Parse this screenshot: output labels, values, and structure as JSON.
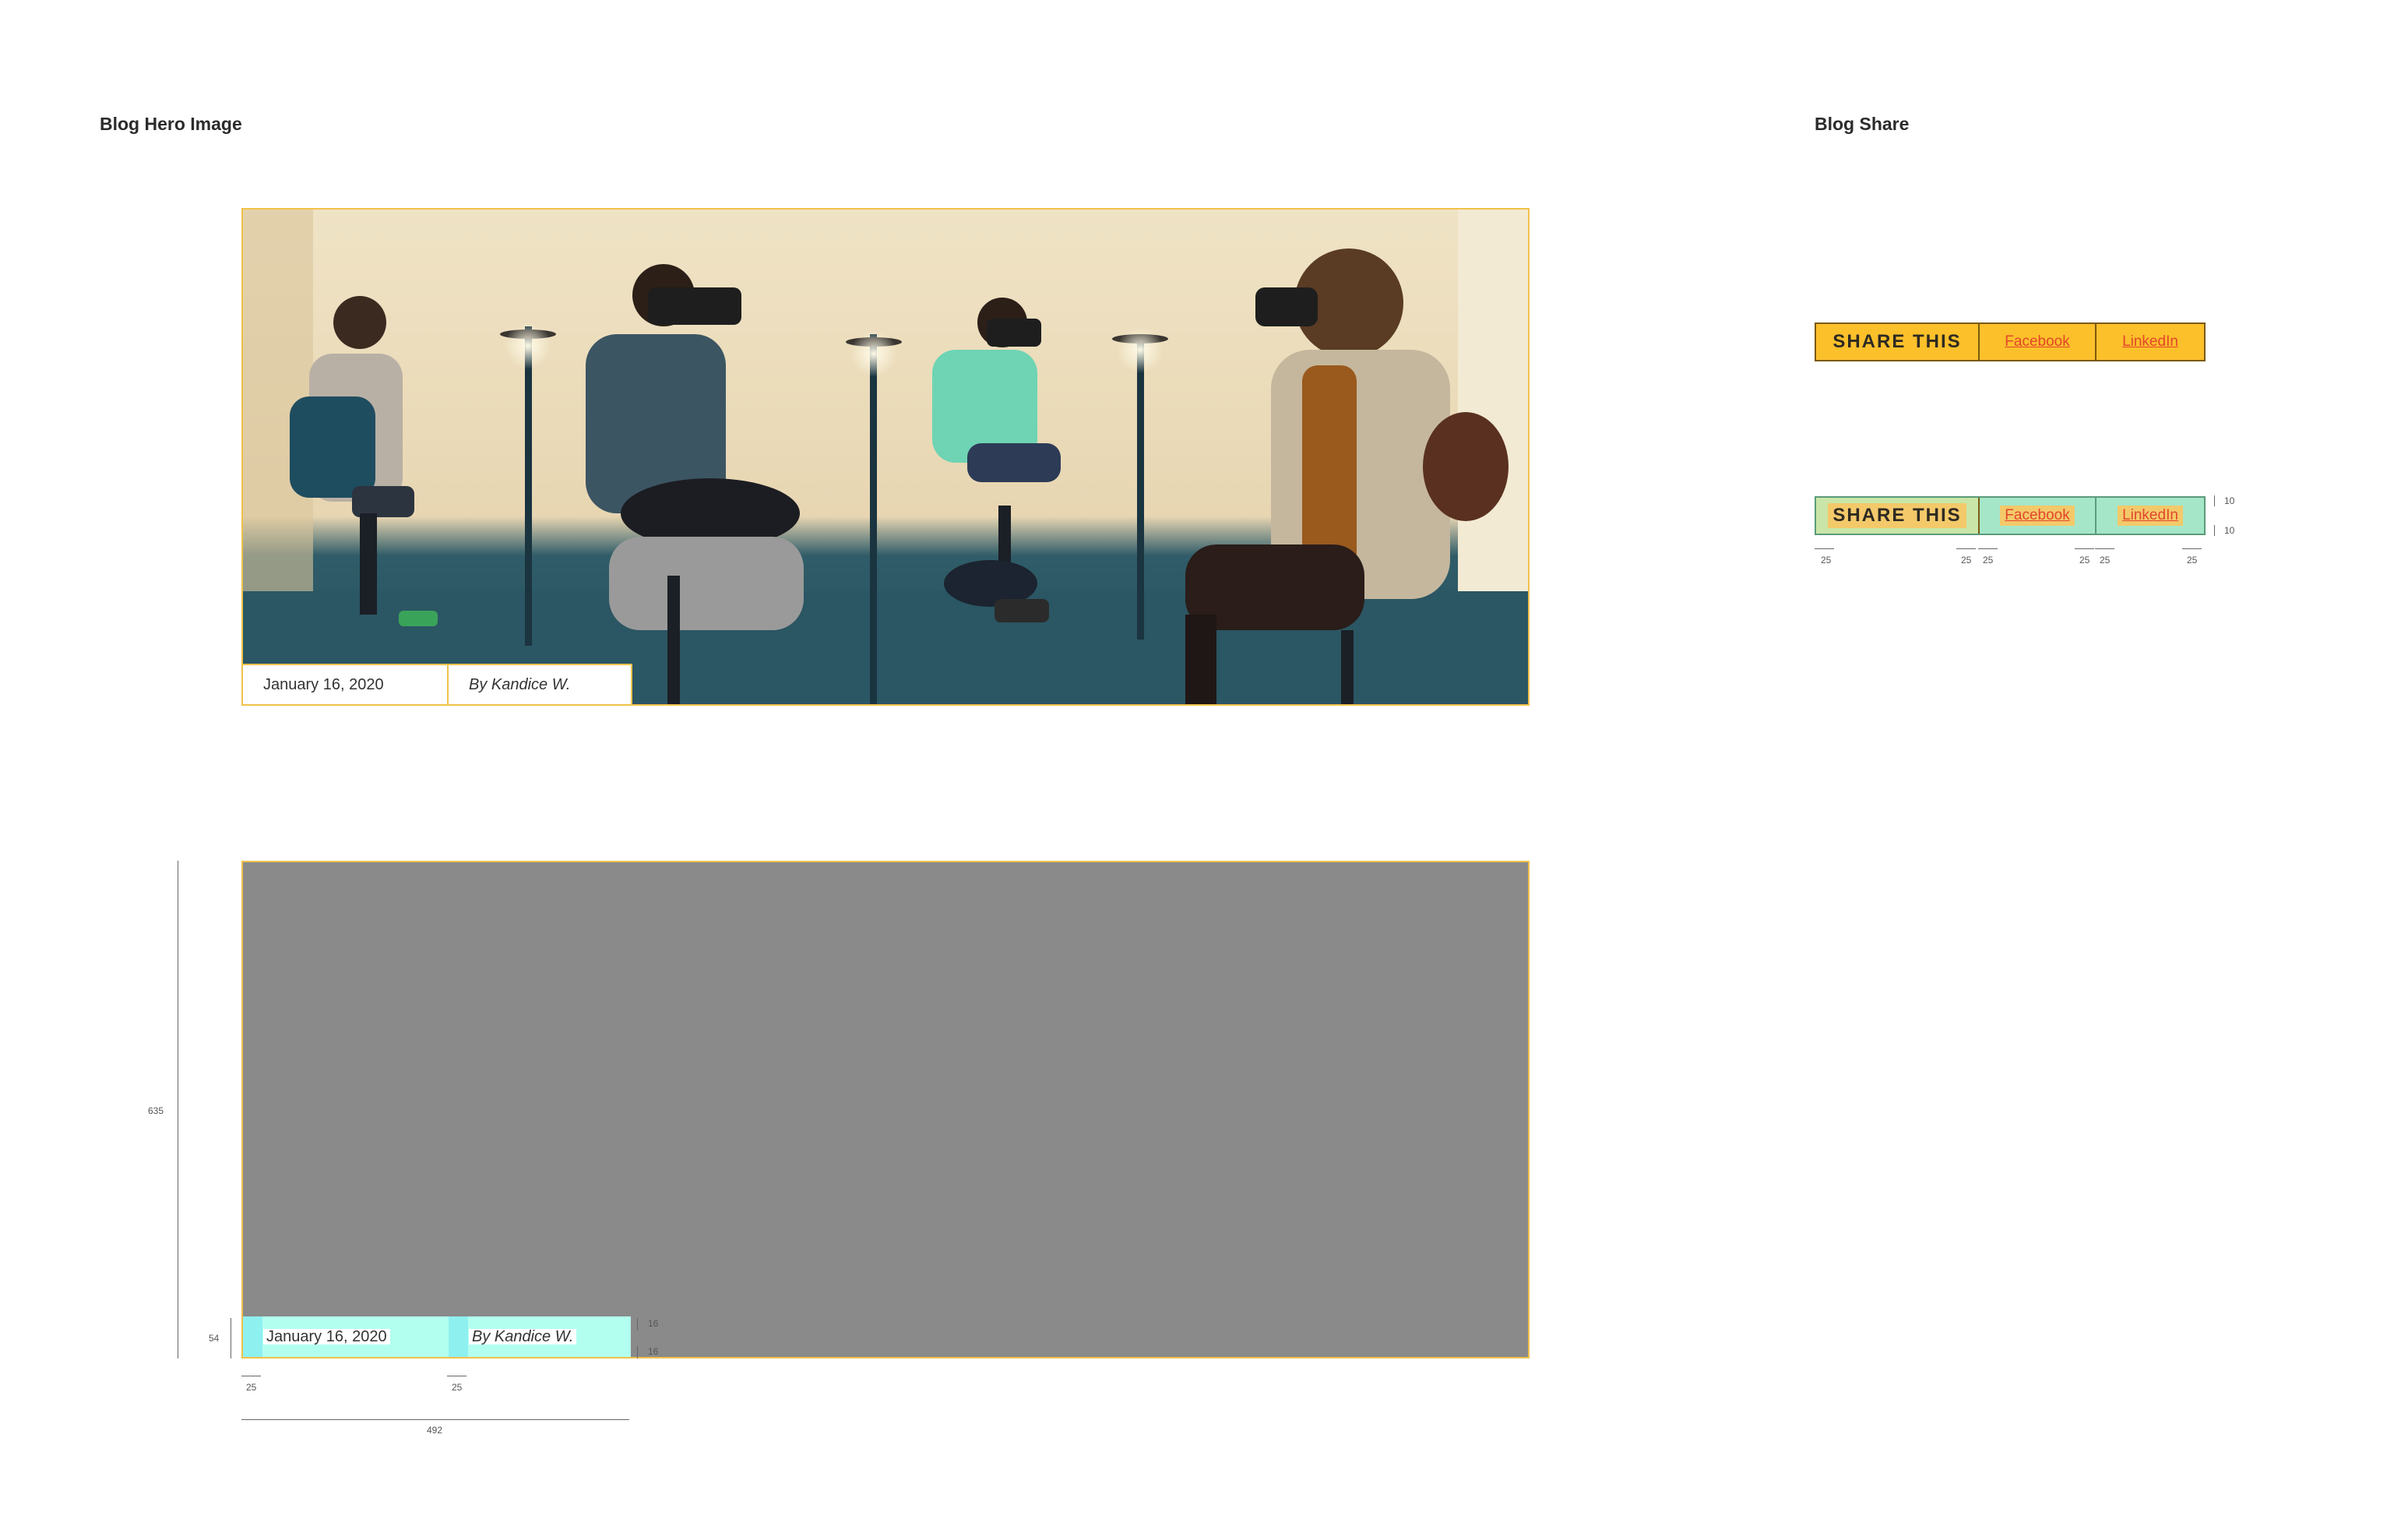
{
  "hero_section": {
    "title": "Blog Hero Image",
    "meta": {
      "date": "January 16, 2020",
      "author": "By Kandice W."
    }
  },
  "share_section": {
    "title": "Blog Share",
    "share_label": "SHARE THIS",
    "links": [
      {
        "label": "Facebook"
      },
      {
        "label": "LinkedIn"
      }
    ]
  },
  "spec": {
    "hero_height": "635",
    "meta_height": "54",
    "meta_width": "492",
    "padding_h": "25",
    "padding_v": "16",
    "share_padding_v": "10",
    "share_padding_h": "25"
  },
  "colors": {
    "accent": "#fcc02b",
    "link": "#e4452a",
    "border": "#f1c24a",
    "placeholder": "#8a8a8a",
    "spec_padding": "#8ef0ef"
  }
}
